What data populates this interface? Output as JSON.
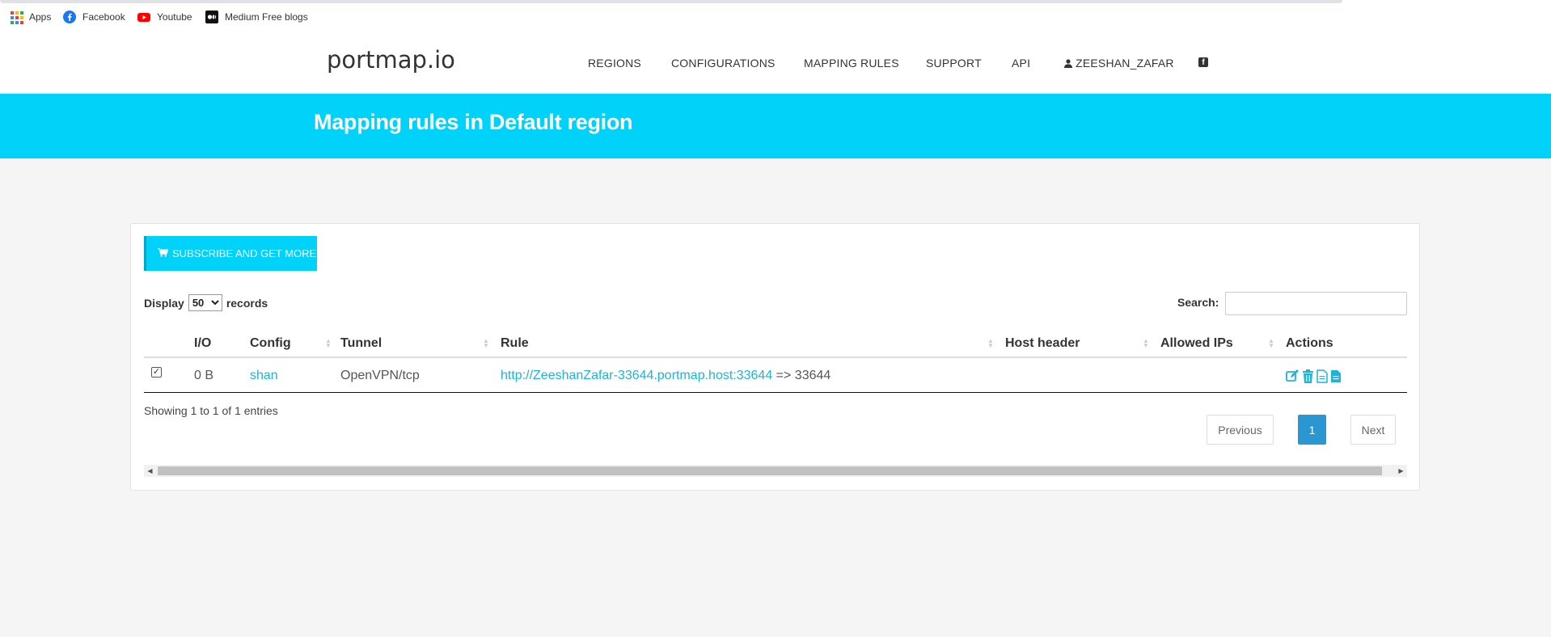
{
  "bookmarks": [
    {
      "label": "Apps",
      "icon": "apps-grid-icon"
    },
    {
      "label": "Facebook",
      "icon": "facebook-icon"
    },
    {
      "label": "Youtube",
      "icon": "youtube-icon"
    },
    {
      "label": "Medium Free blogs",
      "icon": "medium-icon"
    }
  ],
  "header": {
    "logo": "portmap.io",
    "nav": [
      "REGIONS",
      "CONFIGURATIONS",
      "MAPPING RULES",
      "SUPPORT",
      "API",
      "ZEESHAN_ZAFAR"
    ]
  },
  "banner": {
    "title": "Mapping rules in Default region"
  },
  "panel": {
    "subscribe_label": "SUBSCRIBE AND GET MORE",
    "display_label": "Display",
    "display_value": "50",
    "records_label": "records",
    "search_label": "Search:",
    "search_value": "",
    "columns": [
      "I/O",
      "Config",
      "Tunnel",
      "Rule",
      "Host header",
      "Allowed IPs",
      "Actions"
    ],
    "rows": [
      {
        "io": "0 B",
        "config": "shan",
        "tunnel": "OpenVPN/tcp",
        "rule_link": "http://ZeeshanZafar-33644.portmap.host:33644",
        "rule_suffix": "=> 33644",
        "host_header": "",
        "allowed_ips": ""
      }
    ],
    "showing_text": "Showing 1 to 1 of 1 entries",
    "pagination": {
      "previous": "Previous",
      "current": "1",
      "next": "Next"
    }
  },
  "colors": {
    "accent": "#00d2f9",
    "link": "#1fb3d8",
    "page_active": "#2b97d2"
  }
}
